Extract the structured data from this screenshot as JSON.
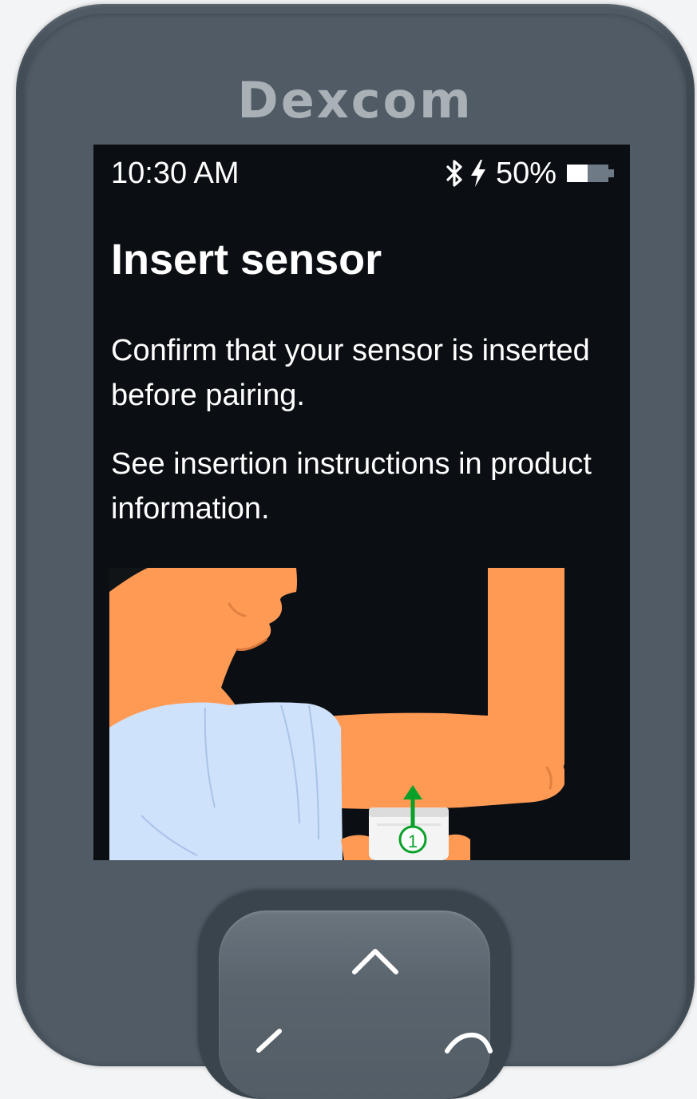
{
  "device": {
    "brand": "Dexcom"
  },
  "status_bar": {
    "time": "10:30 AM",
    "battery_percent": "50%",
    "battery_level": 0.5,
    "icons": [
      "bluetooth-icon",
      "charging-icon",
      "battery-icon"
    ]
  },
  "screen": {
    "title": "Insert sensor",
    "paragraph_1": "Confirm that your sensor is inserted before pairing.",
    "paragraph_2": "See insertion instructions in product information.",
    "illustration_step": "1"
  },
  "navigation": {
    "icons": [
      "chevron-up-icon",
      "chevron-left-icon",
      "chevron-right-icon"
    ]
  },
  "colors": {
    "device_body": "#505b65",
    "screen_background": "#0b0f13",
    "skin": "#ff9a55",
    "shirt": "#cfe2fb",
    "arrow_green": "#0aa02a"
  }
}
